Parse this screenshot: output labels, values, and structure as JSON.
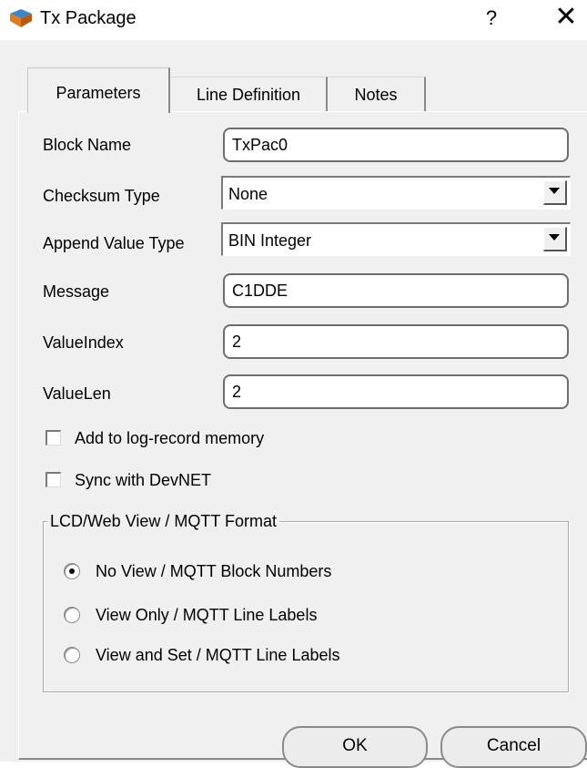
{
  "window": {
    "title": "Tx Package",
    "help_glyph": "?",
    "close_glyph": "✕",
    "app_icon": "block-icon"
  },
  "tabs": [
    {
      "label": "Parameters",
      "active": true
    },
    {
      "label": "Line Definition",
      "active": false
    },
    {
      "label": "Notes",
      "active": false
    }
  ],
  "form": {
    "block_name": {
      "label": "Block Name",
      "value": "TxPac0"
    },
    "checksum_type": {
      "label": "Checksum Type",
      "value": "None"
    },
    "append_value_type": {
      "label": "Append Value Type",
      "value": "BIN Integer"
    },
    "message": {
      "label": "Message",
      "value": "C1DDE"
    },
    "value_index": {
      "label": "ValueIndex",
      "value": "2"
    },
    "value_len": {
      "label": "ValueLen",
      "value": "2"
    }
  },
  "checkboxes": {
    "log_record": {
      "label": "Add to log-record memory",
      "checked": false
    },
    "sync_devnet": {
      "label": "Sync with DevNET",
      "checked": false
    }
  },
  "view_format": {
    "title": "LCD/Web View / MQTT Format",
    "options": [
      {
        "label": "No View / MQTT Block Numbers",
        "selected": true
      },
      {
        "label": "View Only / MQTT Line Labels",
        "selected": false
      },
      {
        "label": "View and Set / MQTT Line Labels",
        "selected": false
      }
    ]
  },
  "buttons": {
    "ok": "OK",
    "cancel": "Cancel"
  }
}
